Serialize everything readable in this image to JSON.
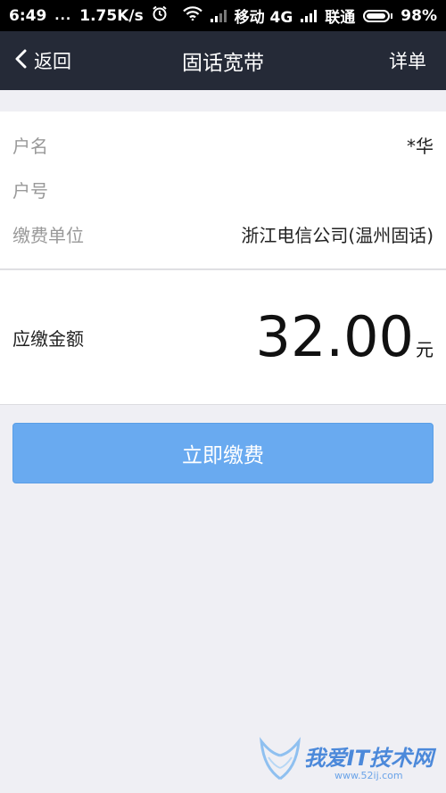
{
  "status_bar": {
    "time": "6:49",
    "dots": "...",
    "speed": "1.75K/s",
    "carrier1": "移动 4G",
    "carrier2": "联通",
    "battery": "98%"
  },
  "nav": {
    "back_label": "返回",
    "title": "固话宽带",
    "right_label": "详单"
  },
  "info": {
    "rows": [
      {
        "label": "户名",
        "value": "*华"
      },
      {
        "label": "户号",
        "value": ""
      },
      {
        "label": "缴费单位",
        "value": "浙江电信公司(温州固话)"
      }
    ]
  },
  "amount": {
    "label": "应缴金额",
    "value": "32.00",
    "unit": "元"
  },
  "pay_button": {
    "label": "立即缴费"
  },
  "watermark": {
    "main": "我爱IT技术网",
    "sub": "www.52ij.com"
  },
  "colors": {
    "nav_bg": "#252a37",
    "button_bg": "#69aaf0",
    "page_bg": "#efeff4"
  }
}
